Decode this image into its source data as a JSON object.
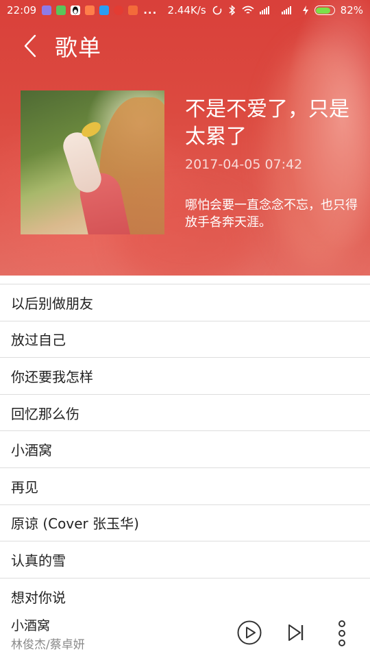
{
  "status_bar": {
    "time": "22:09",
    "net_speed": "2.44K/s",
    "battery_percent": "82%",
    "battery_level": 0.82,
    "more_notifications": "..."
  },
  "header": {
    "title": "歌单"
  },
  "playlist": {
    "title": "不是不爱了，只是太累了",
    "date": "2017-04-05 07:42",
    "description": "哪怕会要一直念念不忘，也只得放手各奔天涯。"
  },
  "songs": [
    "以后别做朋友",
    "放过自己",
    "你还要我怎样",
    "回忆那么伤",
    "小酒窝",
    "再见",
    "原谅 (Cover 张玉华)",
    "认真的雪",
    "想对你说"
  ],
  "now_playing": {
    "song": "小酒窝",
    "artist": "林俊杰/蔡卓妍"
  },
  "colors": {
    "header_red": "#dc4a40",
    "battery_green": "#7be04a",
    "divider": "#dddddd",
    "secondary_text": "#8a8a8a"
  }
}
